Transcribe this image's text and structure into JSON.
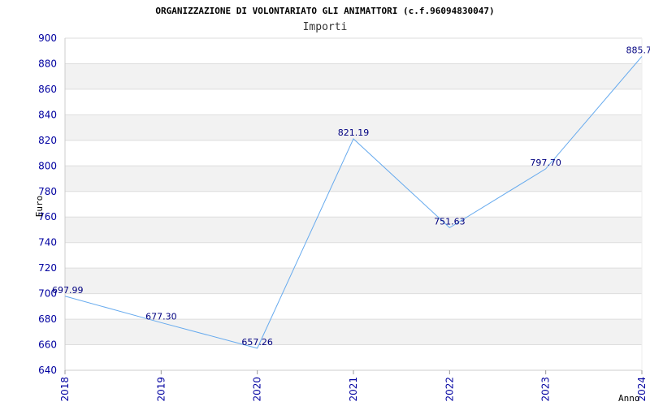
{
  "chart_data": {
    "type": "line",
    "title": "ORGANIZZAZIONE DI VOLONTARIATO GLI ANIMATTORI (c.f.96094830047)",
    "subtitle": "Importi",
    "xlabel": "Anno",
    "ylabel": "Euro",
    "categories": [
      "2018",
      "2019",
      "2020",
      "2021",
      "2022",
      "2023",
      "2024"
    ],
    "series": [
      {
        "values": [
          697.99,
          677.3,
          657.26,
          821.19,
          751.63,
          797.7,
          885.7
        ],
        "labels": [
          "697.99",
          "677.30",
          "657.26",
          "821.19",
          "751.63",
          "797.70",
          "885.7"
        ]
      }
    ],
    "ylim": [
      640,
      900
    ],
    "yticks": [
      "640",
      "660",
      "680",
      "700",
      "720",
      "740",
      "760",
      "780",
      "800",
      "820",
      "840",
      "860",
      "880",
      "900"
    ],
    "grid": true,
    "colors": {
      "line": "#66aaee",
      "band": "#f2f2f2",
      "gridline": "#dddddd",
      "tick": "#0000a0"
    }
  }
}
